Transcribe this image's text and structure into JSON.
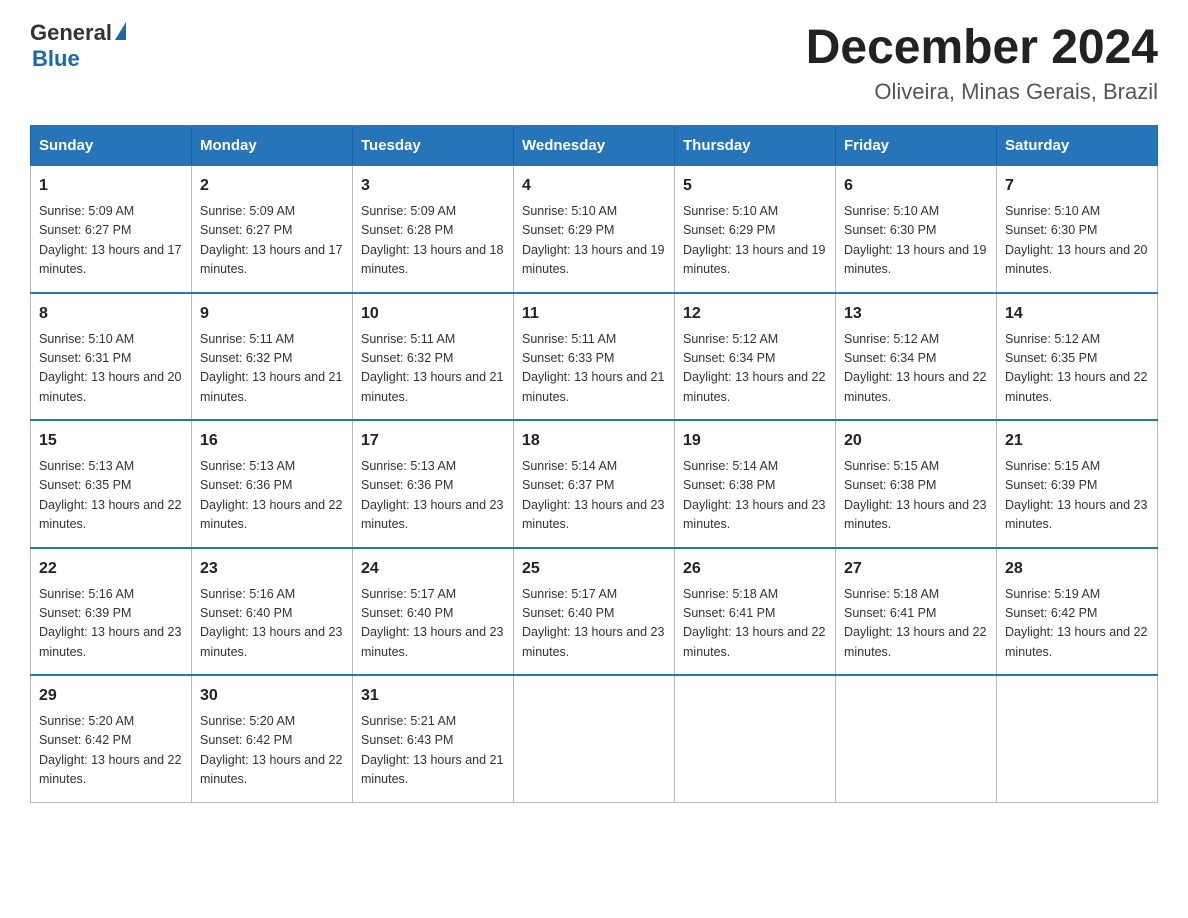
{
  "header": {
    "logo_general": "General",
    "logo_blue": "Blue",
    "month_title": "December 2024",
    "location": "Oliveira, Minas Gerais, Brazil"
  },
  "days_of_week": [
    "Sunday",
    "Monday",
    "Tuesday",
    "Wednesday",
    "Thursday",
    "Friday",
    "Saturday"
  ],
  "weeks": [
    [
      {
        "day": "1",
        "sunrise": "5:09 AM",
        "sunset": "6:27 PM",
        "daylight": "13 hours and 17 minutes."
      },
      {
        "day": "2",
        "sunrise": "5:09 AM",
        "sunset": "6:27 PM",
        "daylight": "13 hours and 17 minutes."
      },
      {
        "day": "3",
        "sunrise": "5:09 AM",
        "sunset": "6:28 PM",
        "daylight": "13 hours and 18 minutes."
      },
      {
        "day": "4",
        "sunrise": "5:10 AM",
        "sunset": "6:29 PM",
        "daylight": "13 hours and 19 minutes."
      },
      {
        "day": "5",
        "sunrise": "5:10 AM",
        "sunset": "6:29 PM",
        "daylight": "13 hours and 19 minutes."
      },
      {
        "day": "6",
        "sunrise": "5:10 AM",
        "sunset": "6:30 PM",
        "daylight": "13 hours and 19 minutes."
      },
      {
        "day": "7",
        "sunrise": "5:10 AM",
        "sunset": "6:30 PM",
        "daylight": "13 hours and 20 minutes."
      }
    ],
    [
      {
        "day": "8",
        "sunrise": "5:10 AM",
        "sunset": "6:31 PM",
        "daylight": "13 hours and 20 minutes."
      },
      {
        "day": "9",
        "sunrise": "5:11 AM",
        "sunset": "6:32 PM",
        "daylight": "13 hours and 21 minutes."
      },
      {
        "day": "10",
        "sunrise": "5:11 AM",
        "sunset": "6:32 PM",
        "daylight": "13 hours and 21 minutes."
      },
      {
        "day": "11",
        "sunrise": "5:11 AM",
        "sunset": "6:33 PM",
        "daylight": "13 hours and 21 minutes."
      },
      {
        "day": "12",
        "sunrise": "5:12 AM",
        "sunset": "6:34 PM",
        "daylight": "13 hours and 22 minutes."
      },
      {
        "day": "13",
        "sunrise": "5:12 AM",
        "sunset": "6:34 PM",
        "daylight": "13 hours and 22 minutes."
      },
      {
        "day": "14",
        "sunrise": "5:12 AM",
        "sunset": "6:35 PM",
        "daylight": "13 hours and 22 minutes."
      }
    ],
    [
      {
        "day": "15",
        "sunrise": "5:13 AM",
        "sunset": "6:35 PM",
        "daylight": "13 hours and 22 minutes."
      },
      {
        "day": "16",
        "sunrise": "5:13 AM",
        "sunset": "6:36 PM",
        "daylight": "13 hours and 22 minutes."
      },
      {
        "day": "17",
        "sunrise": "5:13 AM",
        "sunset": "6:36 PM",
        "daylight": "13 hours and 23 minutes."
      },
      {
        "day": "18",
        "sunrise": "5:14 AM",
        "sunset": "6:37 PM",
        "daylight": "13 hours and 23 minutes."
      },
      {
        "day": "19",
        "sunrise": "5:14 AM",
        "sunset": "6:38 PM",
        "daylight": "13 hours and 23 minutes."
      },
      {
        "day": "20",
        "sunrise": "5:15 AM",
        "sunset": "6:38 PM",
        "daylight": "13 hours and 23 minutes."
      },
      {
        "day": "21",
        "sunrise": "5:15 AM",
        "sunset": "6:39 PM",
        "daylight": "13 hours and 23 minutes."
      }
    ],
    [
      {
        "day": "22",
        "sunrise": "5:16 AM",
        "sunset": "6:39 PM",
        "daylight": "13 hours and 23 minutes."
      },
      {
        "day": "23",
        "sunrise": "5:16 AM",
        "sunset": "6:40 PM",
        "daylight": "13 hours and 23 minutes."
      },
      {
        "day": "24",
        "sunrise": "5:17 AM",
        "sunset": "6:40 PM",
        "daylight": "13 hours and 23 minutes."
      },
      {
        "day": "25",
        "sunrise": "5:17 AM",
        "sunset": "6:40 PM",
        "daylight": "13 hours and 23 minutes."
      },
      {
        "day": "26",
        "sunrise": "5:18 AM",
        "sunset": "6:41 PM",
        "daylight": "13 hours and 22 minutes."
      },
      {
        "day": "27",
        "sunrise": "5:18 AM",
        "sunset": "6:41 PM",
        "daylight": "13 hours and 22 minutes."
      },
      {
        "day": "28",
        "sunrise": "5:19 AM",
        "sunset": "6:42 PM",
        "daylight": "13 hours and 22 minutes."
      }
    ],
    [
      {
        "day": "29",
        "sunrise": "5:20 AM",
        "sunset": "6:42 PM",
        "daylight": "13 hours and 22 minutes."
      },
      {
        "day": "30",
        "sunrise": "5:20 AM",
        "sunset": "6:42 PM",
        "daylight": "13 hours and 22 minutes."
      },
      {
        "day": "31",
        "sunrise": "5:21 AM",
        "sunset": "6:43 PM",
        "daylight": "13 hours and 21 minutes."
      },
      null,
      null,
      null,
      null
    ]
  ],
  "labels": {
    "sunrise_prefix": "Sunrise: ",
    "sunset_prefix": "Sunset: ",
    "daylight_prefix": "Daylight: "
  }
}
